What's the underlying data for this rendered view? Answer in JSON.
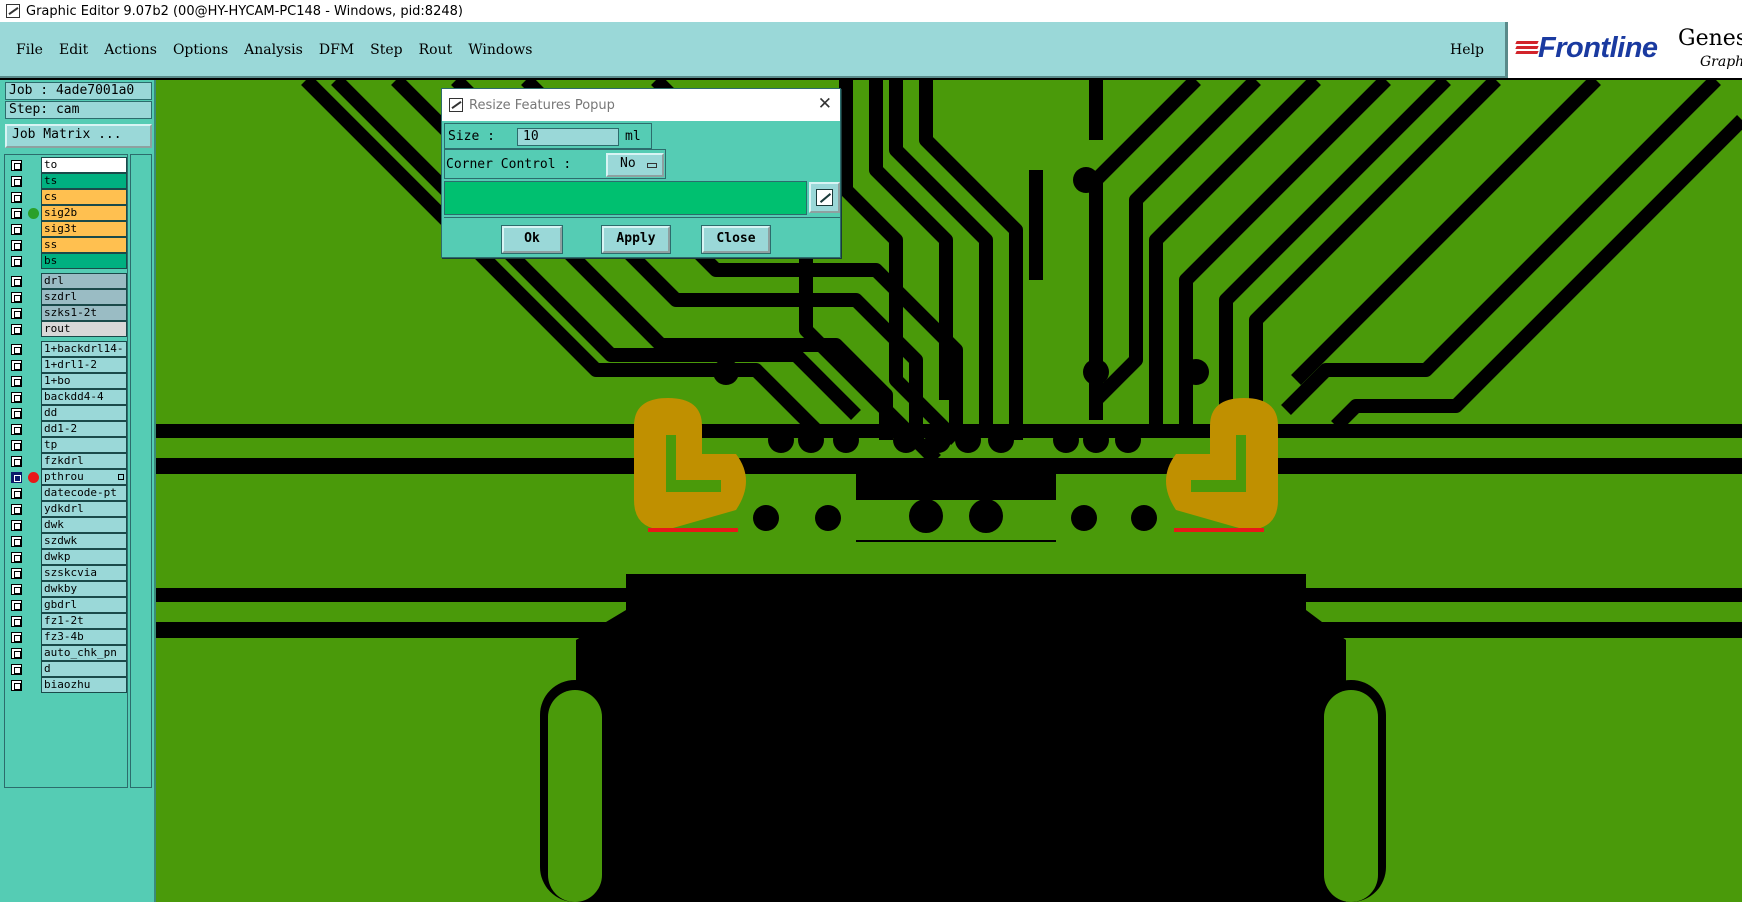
{
  "window": {
    "title": "Graphic Editor 9.07b2 (00@HY-HYCAM-PC148 - Windows, pid:8248)"
  },
  "menubar": {
    "items": [
      {
        "label": "File"
      },
      {
        "label": "Edit"
      },
      {
        "label": "Actions"
      },
      {
        "label": "Options"
      },
      {
        "label": "Analysis"
      },
      {
        "label": "DFM"
      },
      {
        "label": "Step"
      },
      {
        "label": "Rout"
      },
      {
        "label": "Windows"
      }
    ],
    "help": "Help",
    "logo": {
      "brand": "Frontline",
      "product": "Genes",
      "sub": "Graphi"
    }
  },
  "leftpanel": {
    "job": "Job : 4ade7001a0",
    "step": "Step: cam",
    "job_matrix_button": "Job Matrix ...",
    "layers": [
      {
        "name": "to",
        "color": "#ffffff"
      },
      {
        "name": "ts",
        "color": "#00b080"
      },
      {
        "name": "cs",
        "color": "#ffc050"
      },
      {
        "name": "sig2b",
        "color": "#ffc050",
        "indicator": "#2aa02a"
      },
      {
        "name": "sig3t",
        "color": "#ffc050"
      },
      {
        "name": "ss",
        "color": "#ffc050"
      },
      {
        "name": "bs",
        "color": "#00b080"
      },
      {
        "name": "drl",
        "color": "#9abcc4"
      },
      {
        "name": "szdrl",
        "color": "#9abcc4"
      },
      {
        "name": "szks1-2t",
        "color": "#9abcc4"
      },
      {
        "name": "rout",
        "color": "#d8d8d8"
      },
      {
        "name": "1+backdrl14-",
        "color": "#9ad8d8"
      },
      {
        "name": "1+drl1-2",
        "color": "#9ad8d8"
      },
      {
        "name": "1+bo",
        "color": "#9ad8d8"
      },
      {
        "name": "backdd4-4",
        "color": "#9ad8d8"
      },
      {
        "name": "dd",
        "color": "#9ad8d8"
      },
      {
        "name": "dd1-2",
        "color": "#9ad8d8"
      },
      {
        "name": "tp",
        "color": "#9ad8d8"
      },
      {
        "name": "fzkdrl",
        "color": "#9ad8d8"
      },
      {
        "name": "pthrou",
        "color": "#9ad8d8",
        "indicator": "#e81818",
        "selected": true
      },
      {
        "name": "datecode-pt",
        "color": "#9ad8d8"
      },
      {
        "name": "ydkdrl",
        "color": "#9ad8d8"
      },
      {
        "name": "dwk",
        "color": "#9ad8d8"
      },
      {
        "name": "szdwk",
        "color": "#9ad8d8"
      },
      {
        "name": "dwkp",
        "color": "#9ad8d8"
      },
      {
        "name": "szskcvia",
        "color": "#9ad8d8"
      },
      {
        "name": "dwkby",
        "color": "#9ad8d8"
      },
      {
        "name": "gbdrl",
        "color": "#9ad8d8"
      },
      {
        "name": "fz1-2t",
        "color": "#9ad8d8"
      },
      {
        "name": "fz3-4b",
        "color": "#9ad8d8"
      },
      {
        "name": "auto_chk_pn",
        "color": "#9ad8d8"
      },
      {
        "name": "d",
        "color": "#9ad8d8"
      },
      {
        "name": "biaozhu",
        "color": "#9ad8d8"
      }
    ]
  },
  "canvas": {
    "board_color": "#4a9a0a",
    "feature_color": "#000000",
    "highlight_color": "#c09000",
    "highlight_edge": "#e81818"
  },
  "dialog": {
    "title": "Resize Features Popup",
    "size_label": "Size :",
    "size_value": "10",
    "size_unit": "ml",
    "corner_label": "Corner Control :",
    "corner_value": "No",
    "ok": "Ok",
    "apply": "Apply",
    "close": "Close"
  }
}
